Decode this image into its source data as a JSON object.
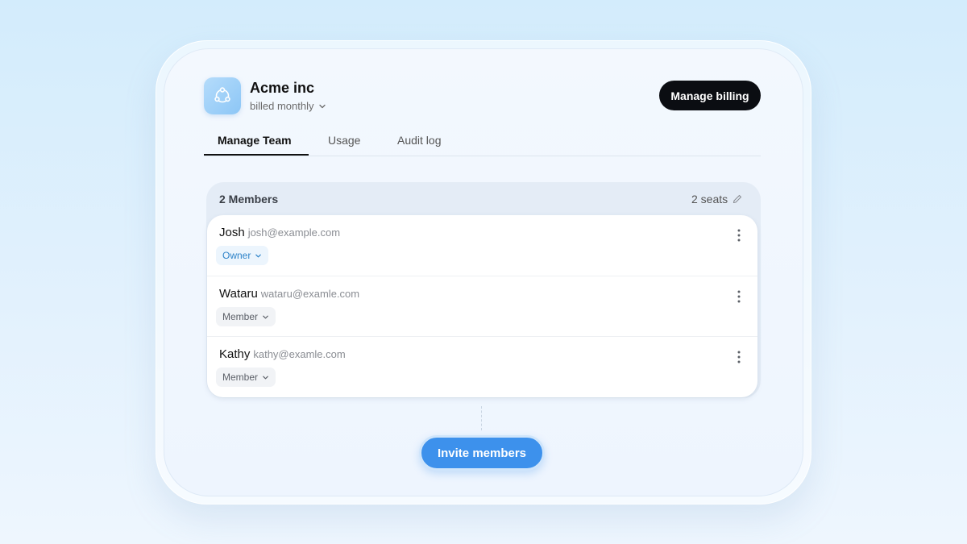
{
  "org": {
    "name": "Acme inc",
    "billing_cycle": "billed monthly"
  },
  "header": {
    "manage_billing_label": "Manage billing"
  },
  "tabs": [
    {
      "label": "Manage Team",
      "active": true
    },
    {
      "label": "Usage",
      "active": false
    },
    {
      "label": "Audit log",
      "active": false
    }
  ],
  "members_panel": {
    "count_label": "2 Members",
    "seats_label": "2 seats",
    "members": [
      {
        "name": "Josh",
        "email": "josh@example.com",
        "role": "Owner"
      },
      {
        "name": "Wataru",
        "email": "wataru@examle.com",
        "role": "Member"
      },
      {
        "name": "Kathy",
        "email": "kathy@examle.com",
        "role": "Member"
      }
    ]
  },
  "actions": {
    "invite_label": "Invite members"
  },
  "colors": {
    "accent": "#3d91ec",
    "owner_role": "#2f84c9",
    "billing_button": "#0b0d12"
  },
  "icons": {
    "logo": "share-nodes-icon",
    "dropdown": "chevron-down-icon",
    "edit": "pencil-icon",
    "more": "kebab-menu-icon"
  }
}
